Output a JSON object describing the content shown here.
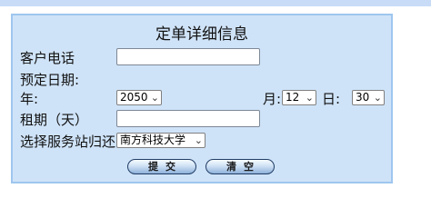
{
  "form": {
    "title": "定单详细信息",
    "phone_label": "客户电话",
    "phone_value": "",
    "date_label": "预定日期:",
    "year_label": "年:",
    "year_value": "2050",
    "month_label": "月:",
    "month_value": "12",
    "day_label": "日:",
    "day_value": "30",
    "rent_label": "租期（天）",
    "rent_value": "",
    "return_label": "选择服务站归还",
    "return_value": "南方科技大学",
    "submit_label": "提交",
    "clear_label": "清空"
  },
  "icons": {
    "dropdown": "chevron-down-icon"
  }
}
